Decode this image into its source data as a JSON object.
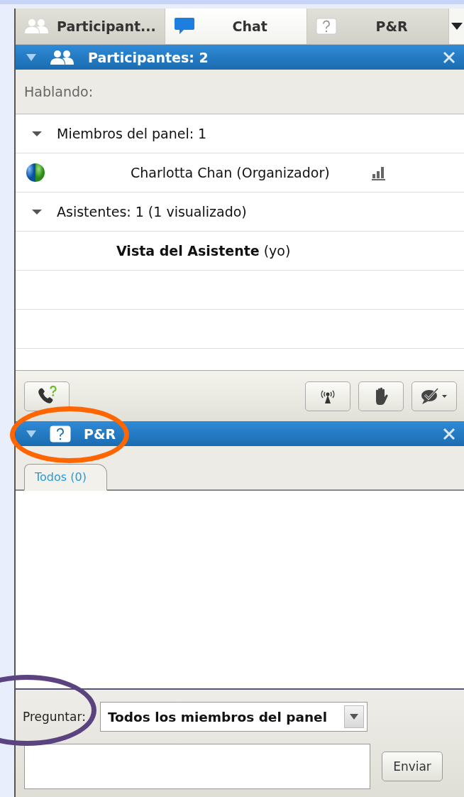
{
  "top_tabs": [
    {
      "label": "Participant...",
      "kind": "participants",
      "selected": false
    },
    {
      "label": "Chat",
      "kind": "chat",
      "selected": true
    },
    {
      "label": "P&R",
      "kind": "qa",
      "selected": false
    }
  ],
  "participants_panel": {
    "title": "Participantes: 2",
    "expanded": true,
    "speaking_label": "Hablando:",
    "rows": [
      {
        "kind": "group",
        "label": "Miembros del panel: 1",
        "expanded": true
      },
      {
        "kind": "panelist",
        "name": "Charlotta Chan (Organizador)"
      },
      {
        "kind": "group",
        "label": "Asistentes: 1 (1 visualizado)",
        "expanded": true
      },
      {
        "kind": "attendee",
        "name": "**Vista del Asistente** (yo)"
      }
    ]
  },
  "qa_panel": {
    "title": "P&R",
    "expanded": true,
    "tabs": [
      {
        "label": "Todos (0)",
        "selected": true
      }
    ],
    "ask_label": "Preguntar:",
    "ask_to": "Todos los miembros del panel",
    "send_button": "Enviar"
  },
  "annotations": [
    {
      "color": "#ff6600"
    },
    {
      "color": "#5b4380"
    }
  ]
}
